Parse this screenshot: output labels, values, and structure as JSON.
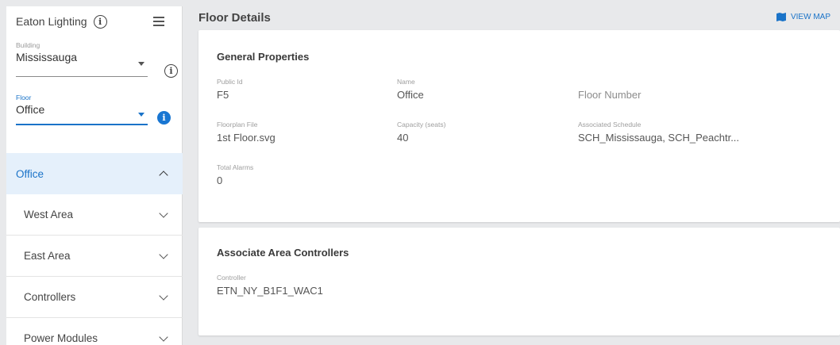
{
  "sidebar": {
    "title": "Eaton Lighting",
    "building_label": "Building",
    "building_value": "Mississauga",
    "floor_label": "Floor",
    "floor_value": "Office",
    "nav": [
      {
        "label": "Office",
        "active": true
      },
      {
        "label": "West Area"
      },
      {
        "label": "East Area"
      },
      {
        "label": "Controllers"
      },
      {
        "label": "Power Modules"
      }
    ]
  },
  "main": {
    "title": "Floor Details",
    "view_map": "VIEW MAP",
    "general": {
      "title": "General Properties",
      "public_id_label": "Public Id",
      "public_id_value": "F5",
      "name_label": "Name",
      "name_value": "Office",
      "floor_number_placeholder": "Floor Number",
      "floorplan_label": "Floorplan File",
      "floorplan_value": "1st Floor.svg",
      "capacity_label": "Capacity (seats)",
      "capacity_value": "40",
      "schedule_label": "Associated Schedule",
      "schedule_value": "SCH_Mississauga, SCH_Peachtr...",
      "alarms_label": "Total Alarms",
      "alarms_value": "0"
    },
    "controllers": {
      "title": "Associate Area Controllers",
      "controller_label": "Controller",
      "controller_value": "ETN_NY_B1F1_WAC1"
    }
  },
  "colors": {
    "accent": "#1a73c8",
    "active_bg": "#e5f0fb",
    "background": "#e8e9eb"
  }
}
